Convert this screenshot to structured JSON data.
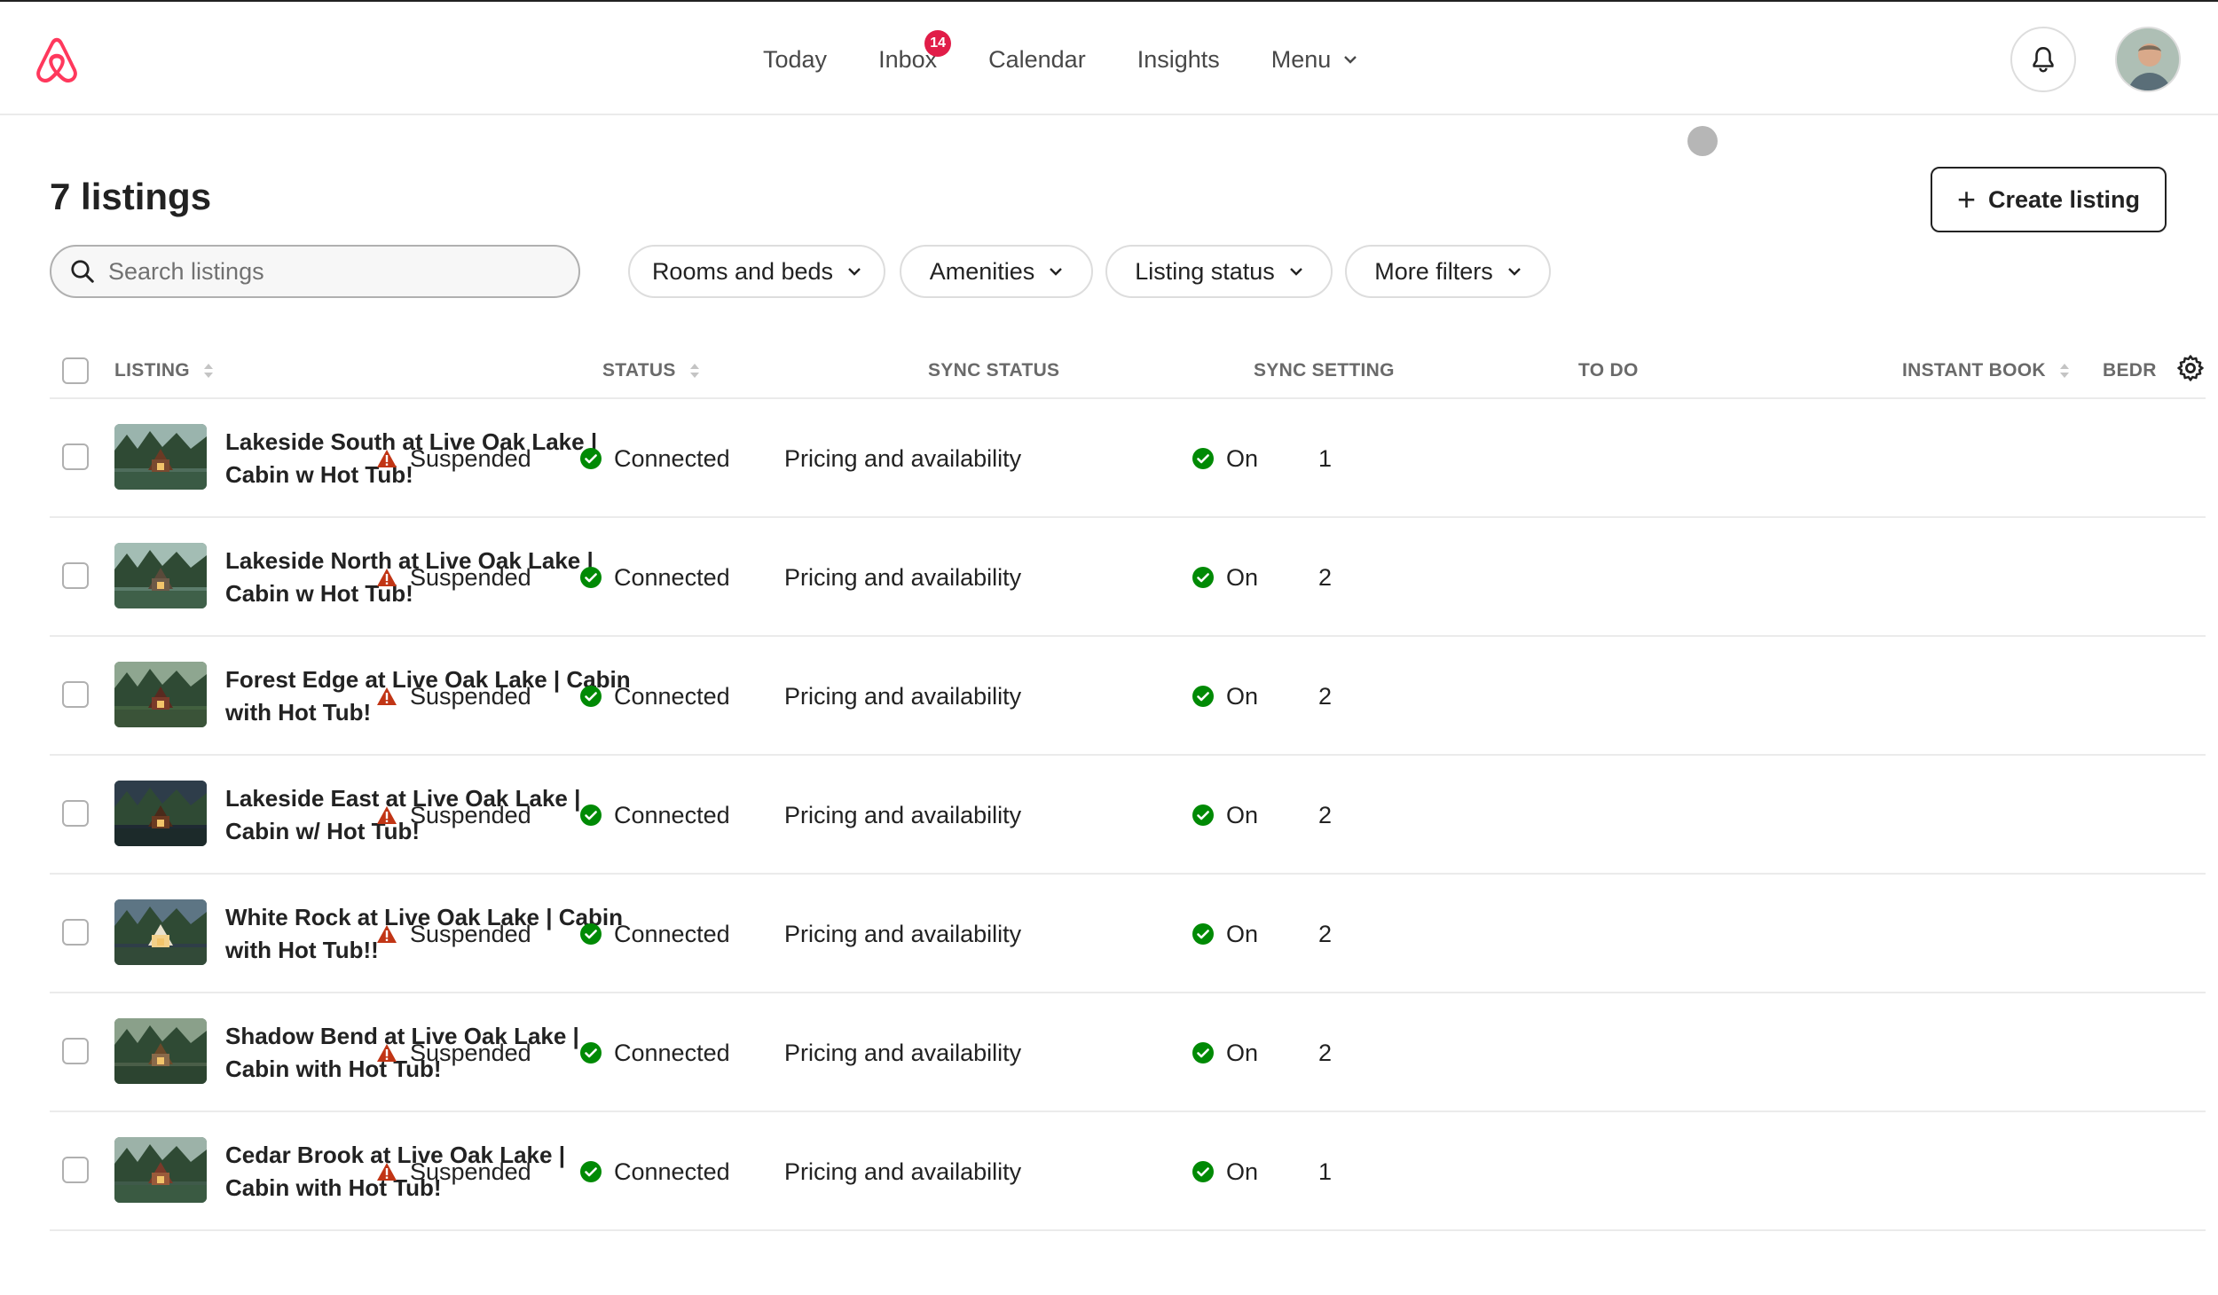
{
  "nav": {
    "items": [
      {
        "label": "Today"
      },
      {
        "label": "Inbox",
        "badge": "14"
      },
      {
        "label": "Calendar"
      },
      {
        "label": "Insights"
      },
      {
        "label": "Menu"
      }
    ]
  },
  "page": {
    "title": "7 listings",
    "create_label": "Create listing"
  },
  "search": {
    "placeholder": "Search listings"
  },
  "filters": [
    "Rooms and beds",
    "Amenities",
    "Listing status",
    "More filters"
  ],
  "table": {
    "headers": {
      "listing": "LISTING",
      "status": "STATUS",
      "sync_status": "SYNC STATUS",
      "sync_setting": "SYNC SETTING",
      "todo": "TO DO",
      "instant_book": "INSTANT BOOK",
      "bedrooms": "BEDR"
    },
    "rows": [
      {
        "name": "Lakeside South at Live Oak Lake | Cabin w Hot Tub!",
        "status": "Suspended",
        "sync_status": "Connected",
        "sync_setting": "Pricing and availability",
        "instant_book": "On",
        "bedrooms": "1"
      },
      {
        "name": "Lakeside North at Live Oak Lake | Cabin w Hot Tub!",
        "status": "Suspended",
        "sync_status": "Connected",
        "sync_setting": "Pricing and availability",
        "instant_book": "On",
        "bedrooms": "2"
      },
      {
        "name": "Forest Edge at Live Oak Lake | Cabin with Hot Tub!",
        "status": "Suspended",
        "sync_status": "Connected",
        "sync_setting": "Pricing and availability",
        "instant_book": "On",
        "bedrooms": "2"
      },
      {
        "name": "Lakeside East at Live Oak Lake | Cabin w/ Hot Tub!",
        "status": "Suspended",
        "sync_status": "Connected",
        "sync_setting": "Pricing and availability",
        "instant_book": "On",
        "bedrooms": "2"
      },
      {
        "name": "White Rock at Live Oak Lake | Cabin with Hot Tub!!",
        "status": "Suspended",
        "sync_status": "Connected",
        "sync_setting": "Pricing and availability",
        "instant_book": "On",
        "bedrooms": "2"
      },
      {
        "name": "Shadow Bend at Live Oak Lake | Cabin with Hot Tub!",
        "status": "Suspended",
        "sync_status": "Connected",
        "sync_setting": "Pricing and availability",
        "instant_book": "On",
        "bedrooms": "2"
      },
      {
        "name": "Cedar Brook at Live Oak Lake | Cabin with Hot Tub!",
        "status": "Suspended",
        "sync_status": "Connected",
        "sync_setting": "Pricing and availability",
        "instant_book": "On",
        "bedrooms": "1"
      }
    ]
  },
  "colors": {
    "brand": "#FF385C",
    "warning": "#C13515",
    "success": "#008A05",
    "badge": "#E11D48"
  },
  "icons": {
    "logo": "airbnb-logo-icon",
    "bell": "bell-icon",
    "search": "search-icon",
    "chevron": "chevron-down-icon",
    "sort": "sort-icon",
    "warning": "warning-icon",
    "check": "check-circle-icon",
    "gear": "gear-icon"
  }
}
